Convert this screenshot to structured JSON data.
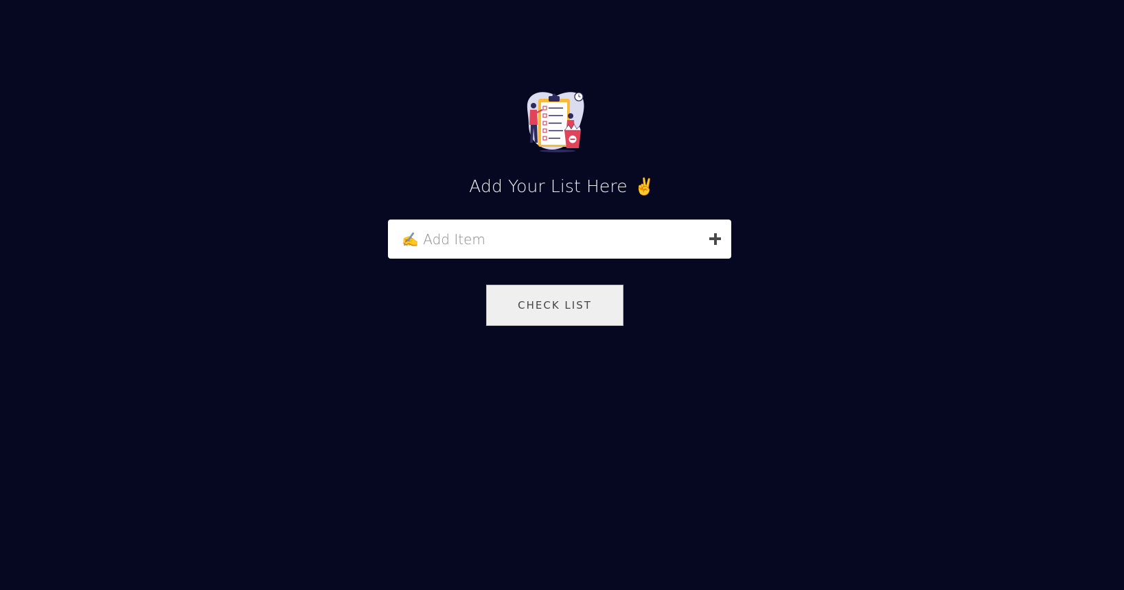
{
  "header": {
    "title": "Add Your List Here",
    "title_emoji": "✌",
    "logo_icon": "checklist-illustration-icon"
  },
  "add_item": {
    "placeholder": "✍ Add Item",
    "value": "",
    "add_icon": "plus-icon"
  },
  "actions": {
    "check_list_label": "CHECK LIST"
  },
  "colors": {
    "background": "#060822",
    "input_background": "#ffffff",
    "button_background": "#efefef"
  }
}
